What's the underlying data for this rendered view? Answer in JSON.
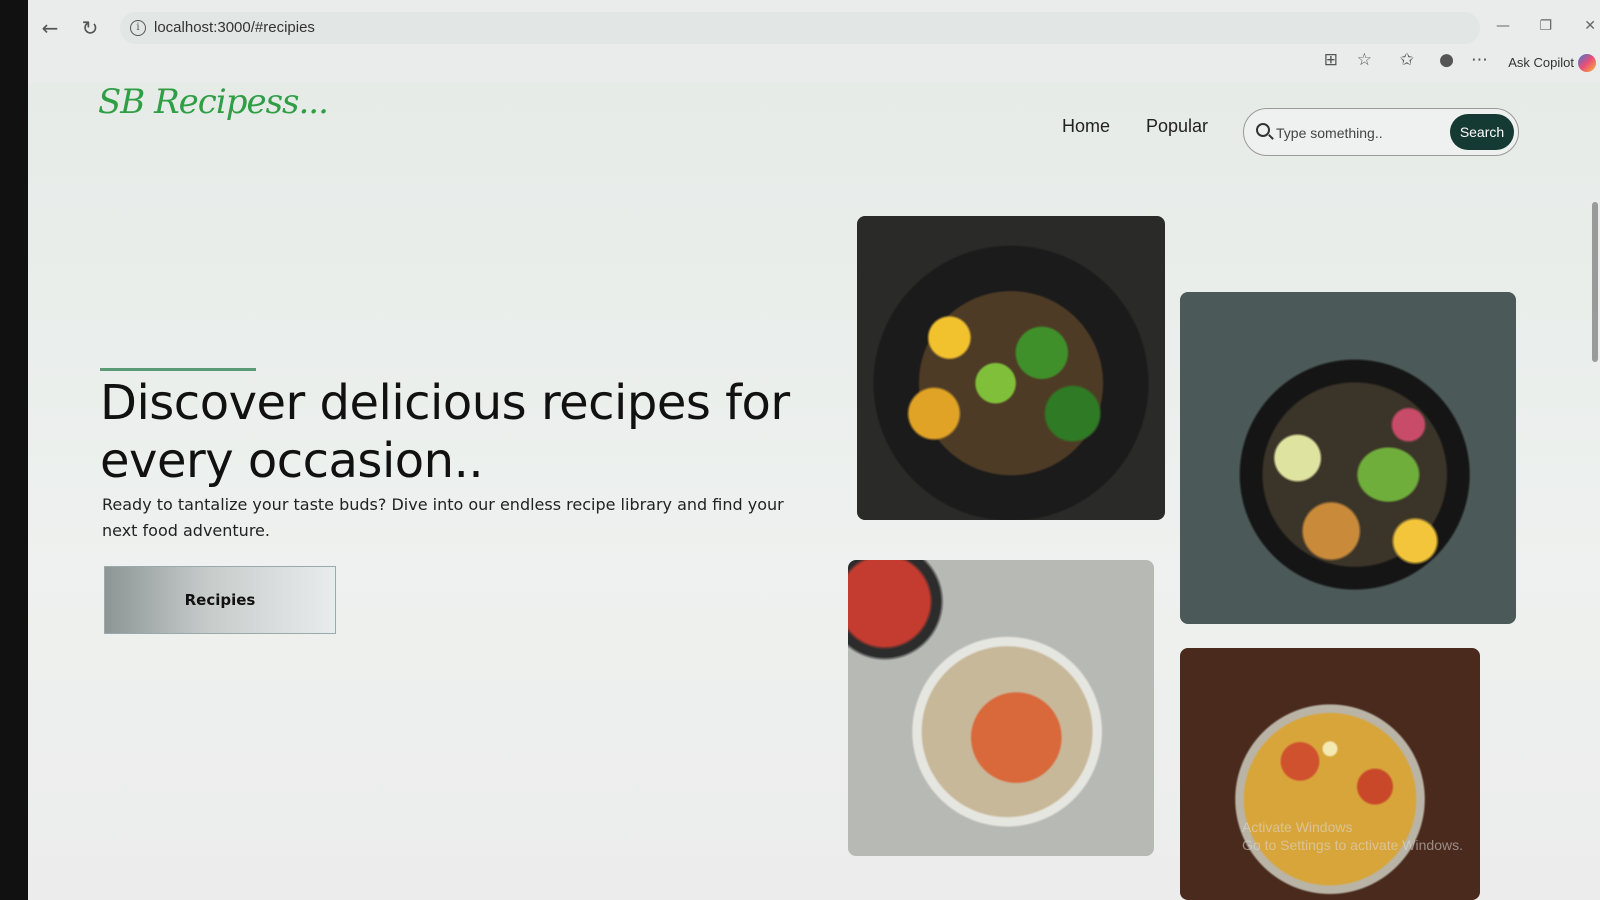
{
  "browser": {
    "url": "localhost:3000/#recipies",
    "ask_copilot": "Ask Copilot"
  },
  "site": {
    "logo": "SB Recipess...",
    "nav": {
      "home": "Home",
      "popular": "Popular"
    },
    "search": {
      "placeholder": "Type something..",
      "button": "Search"
    }
  },
  "hero": {
    "title": "Discover delicious recipes for every occasion..",
    "description": "Ready to tantalize your taste buds? Dive into our endless recipe library and find your next food adventure.",
    "button": "Recipies"
  },
  "watermark": {
    "line1": "Activate Windows",
    "line2": "Go to Settings to activate Windows."
  },
  "icons": [
    "back-icon",
    "reload-icon",
    "info-icon",
    "apps-icon",
    "star-icon",
    "favorites-icon",
    "profile-icon",
    "more-icon",
    "copilot-icon",
    "search-icon"
  ],
  "colors": {
    "logo": "#2f9e44",
    "search_button": "#153a33",
    "accent_line": "#5a9a74"
  }
}
